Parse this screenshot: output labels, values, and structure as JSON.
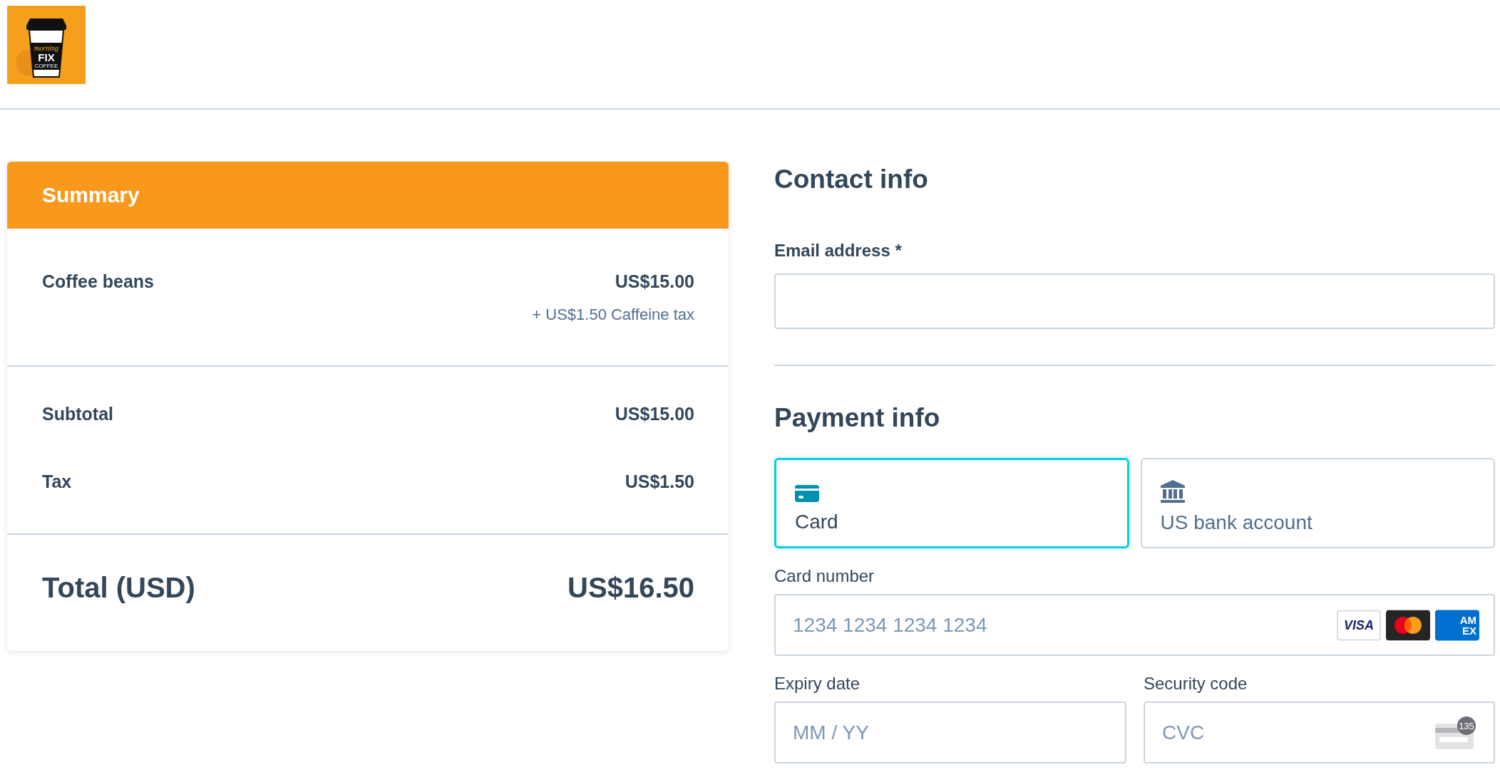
{
  "logo": {
    "script": "morning",
    "word": "FIX",
    "sub": "COFFEE"
  },
  "summary": {
    "title": "Summary",
    "items": [
      {
        "name": "Coffee beans",
        "price": "US$15.00",
        "note": "+ US$1.50 Caffeine tax"
      }
    ],
    "totals": [
      {
        "label": "Subtotal",
        "value": "US$15.00"
      },
      {
        "label": "Tax",
        "value": "US$1.50"
      }
    ],
    "total": {
      "label": "Total (USD)",
      "value": "US$16.50"
    }
  },
  "contact": {
    "title": "Contact info",
    "email": {
      "label": "Email address *"
    }
  },
  "payment": {
    "title": "Payment info",
    "methods": [
      {
        "kind": "card",
        "label": "Card",
        "selected": true
      },
      {
        "kind": "bank",
        "label": "US bank account",
        "selected": false
      }
    ],
    "card_number": {
      "label": "Card number",
      "placeholder": "1234 1234 1234 1234",
      "brands": [
        {
          "kind": "visa",
          "lines": [
            "VISA"
          ]
        },
        {
          "kind": "mastercard"
        },
        {
          "kind": "amex",
          "lines": [
            "AM",
            "EX"
          ]
        }
      ]
    },
    "expiry": {
      "label": "Expiry date",
      "placeholder": "MM / YY"
    },
    "security": {
      "label": "Security code",
      "placeholder": "CVC",
      "badge": "135"
    }
  }
}
